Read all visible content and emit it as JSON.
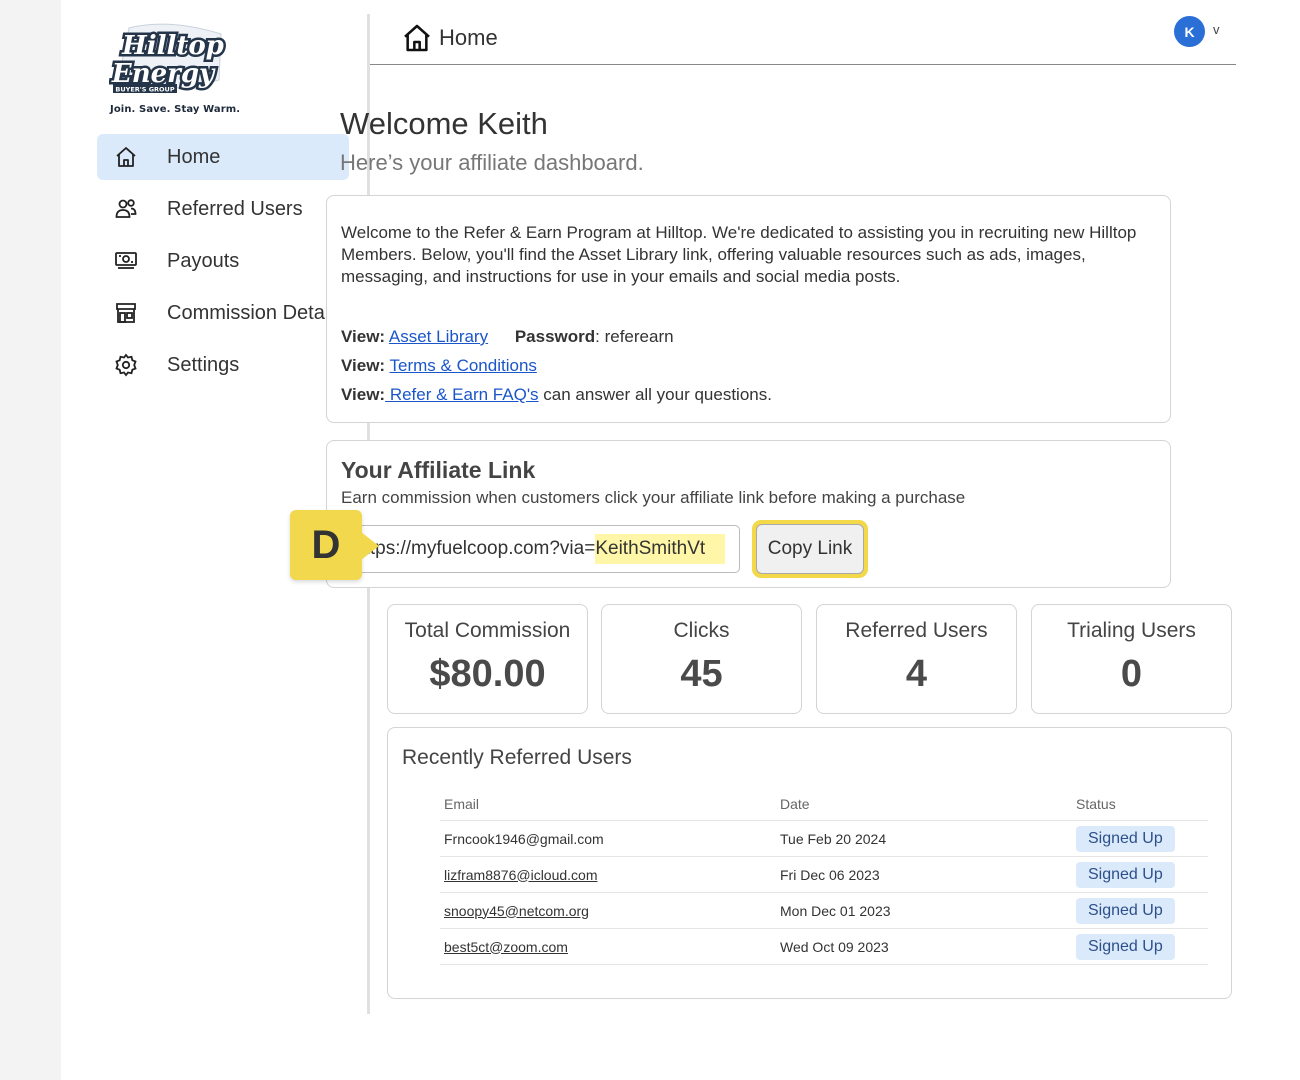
{
  "logo": {
    "line1": "Hilltop",
    "line2": "Energy",
    "line3": "BUYER'S GROUP",
    "tagline": "Join. Save. Stay Warm."
  },
  "sidebar": {
    "items": [
      {
        "label": "Home",
        "icon": "home-icon",
        "active": true
      },
      {
        "label": "Referred Users",
        "icon": "users-icon"
      },
      {
        "label": "Payouts",
        "icon": "money-icon"
      },
      {
        "label": "Commission Details",
        "icon": "store-icon"
      },
      {
        "label": "Settings",
        "icon": "gear-icon"
      }
    ]
  },
  "header": {
    "title": "Home",
    "avatar_initial": "K",
    "avatar_caret": "v"
  },
  "main": {
    "welcome": "Welcome Keith",
    "subtitle": "Here’s your affiliate dashboard.",
    "intro": "Welcome to the Refer & Earn Program at Hilltop. We're dedicated to assisting you in recruiting new Hilltop Members. Below, you'll find the Asset Library link, offering valuable resources such as ads, images, messaging, and instructions for use in your emails and social media posts.",
    "links": {
      "view_label": "View:",
      "asset_library": "Asset Library",
      "password_label": "Password",
      "password_value": ": referearn",
      "terms": "Terms & Conditions",
      "faq": " Refer & Earn FAQ's",
      "faq_suffix": " can answer all your questions."
    },
    "affiliate": {
      "title": "Your Affiliate Link",
      "subtitle": "Earn commission when customers click your affiliate link before making a purchase",
      "url_prefix": "https://myfuelcoop.com?via=",
      "url_code": "KeithSmithVt",
      "copy_label": "Copy Link",
      "marker": "D"
    },
    "stats": [
      {
        "label": "Total Commission",
        "value": "$80.00"
      },
      {
        "label": "Clicks",
        "value": "45"
      },
      {
        "label": "Referred Users",
        "value": "4"
      },
      {
        "label": "Trialing Users",
        "value": "0"
      }
    ],
    "recent": {
      "title": "Recently Referred Users",
      "columns": [
        "Email",
        "Date",
        "Status"
      ],
      "rows": [
        {
          "email": "Frncook1946@gmail.com",
          "date": "Tue Feb 20 2024",
          "status": "Signed Up"
        },
        {
          "email": "lizfram8876@icloud.com",
          "date": "Fri Dec 06 2023",
          "status": "Signed Up"
        },
        {
          "email": "snoopy45@netcom.org",
          "date": "Mon Dec 01 2023",
          "status": "Signed Up"
        },
        {
          "email": "best5ct@zoom.com",
          "date": "Wed Oct 09 2023",
          "status": "Signed Up"
        }
      ]
    }
  }
}
